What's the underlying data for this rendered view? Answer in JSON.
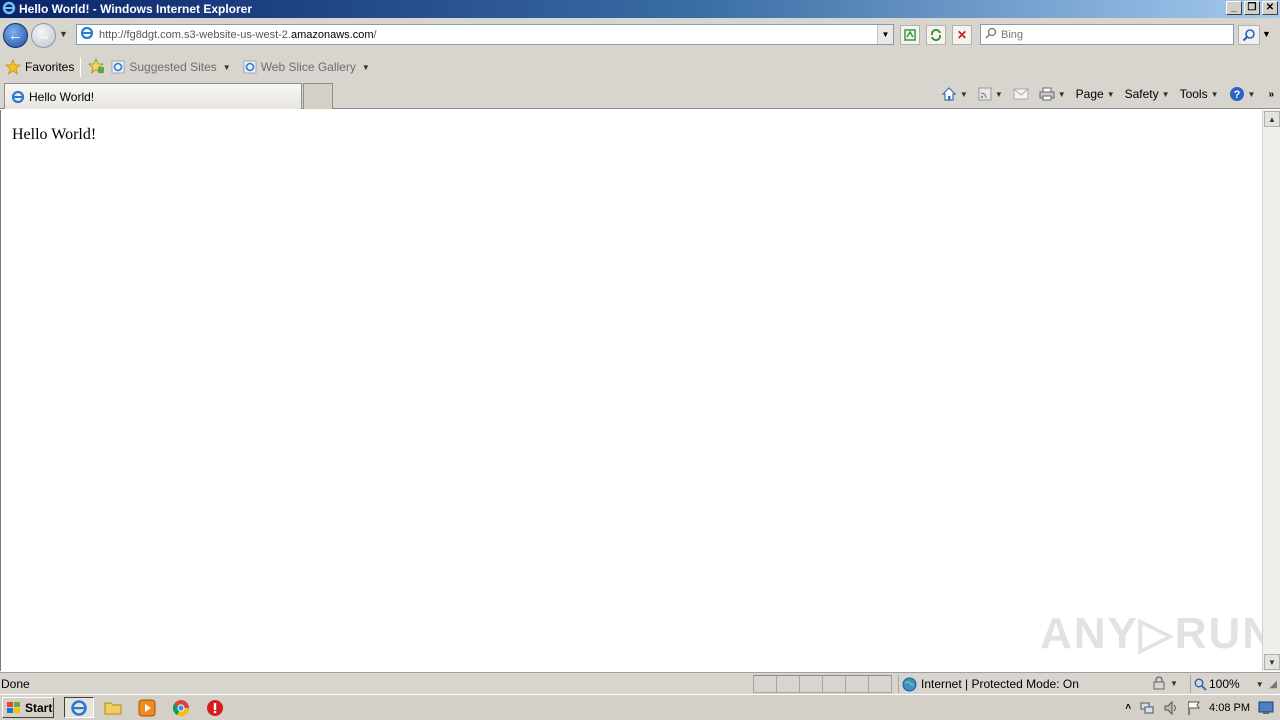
{
  "window": {
    "title": "Hello World! - Windows Internet Explorer",
    "controls": {
      "minimize": "_",
      "restore": "❐",
      "close": "✕"
    }
  },
  "nav": {
    "url_prefix": "http://fg8dgt.com.s3-website-us-west-2.",
    "url_domain": "amazonaws.com",
    "url_suffix": "/",
    "search_placeholder": "Bing"
  },
  "favorites_bar": {
    "favorites_label": "Favorites",
    "links": [
      {
        "label": "Suggested Sites"
      },
      {
        "label": "Web Slice Gallery"
      }
    ]
  },
  "tab": {
    "title": "Hello World!"
  },
  "command_bar": {
    "page": "Page",
    "safety": "Safety",
    "tools": "Tools"
  },
  "content": {
    "text": "Hello World!"
  },
  "watermark": {
    "text": "ANY▷RUN"
  },
  "status": {
    "text": "Done",
    "zone": "Internet | Protected Mode: On",
    "zoom": "100%"
  },
  "taskbar": {
    "start_label": "Start",
    "clock": "4:08 PM"
  }
}
